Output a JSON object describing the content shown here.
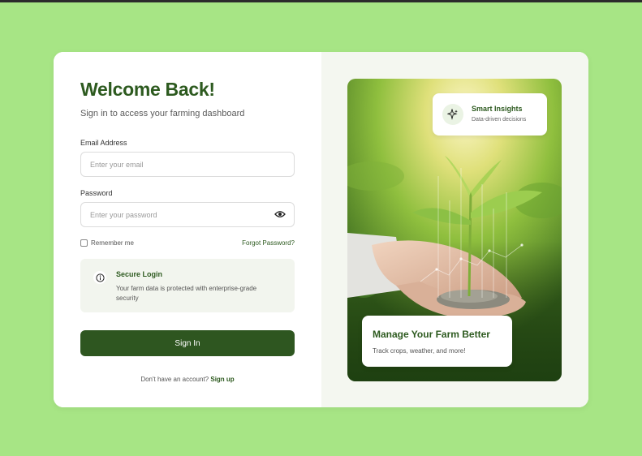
{
  "login": {
    "title": "Welcome Back!",
    "subtitle": "Sign in to access your farming dashboard",
    "email": {
      "label": "Email Address",
      "placeholder": "Enter your email",
      "value": ""
    },
    "password": {
      "label": "Password",
      "placeholder": "Enter your password",
      "value": "",
      "toggle_icon": "eye-icon"
    },
    "remember_label": "Remember me",
    "forgot_label": "Forgot Password?",
    "secure": {
      "icon": "info-icon",
      "title": "Secure Login",
      "text": "Your farm data is protected with enterprise-grade security"
    },
    "signin_label": "Sign In",
    "no_account_text": "Don't have an account?",
    "signup_label": "Sign up"
  },
  "hero": {
    "image": "hands-holding-soil-with-seedling",
    "insights": {
      "icon": "sparkle-icon",
      "title": "Smart Insights",
      "subtitle": "Data-driven decisions"
    },
    "feature": {
      "title": "Manage Your Farm Better",
      "subtitle": "Track crops, weather, and more!"
    }
  },
  "colors": {
    "background": "#a7e585",
    "brand_green": "#2d5a1f",
    "button": "#2e5620",
    "panel": "#f4f7f0"
  }
}
